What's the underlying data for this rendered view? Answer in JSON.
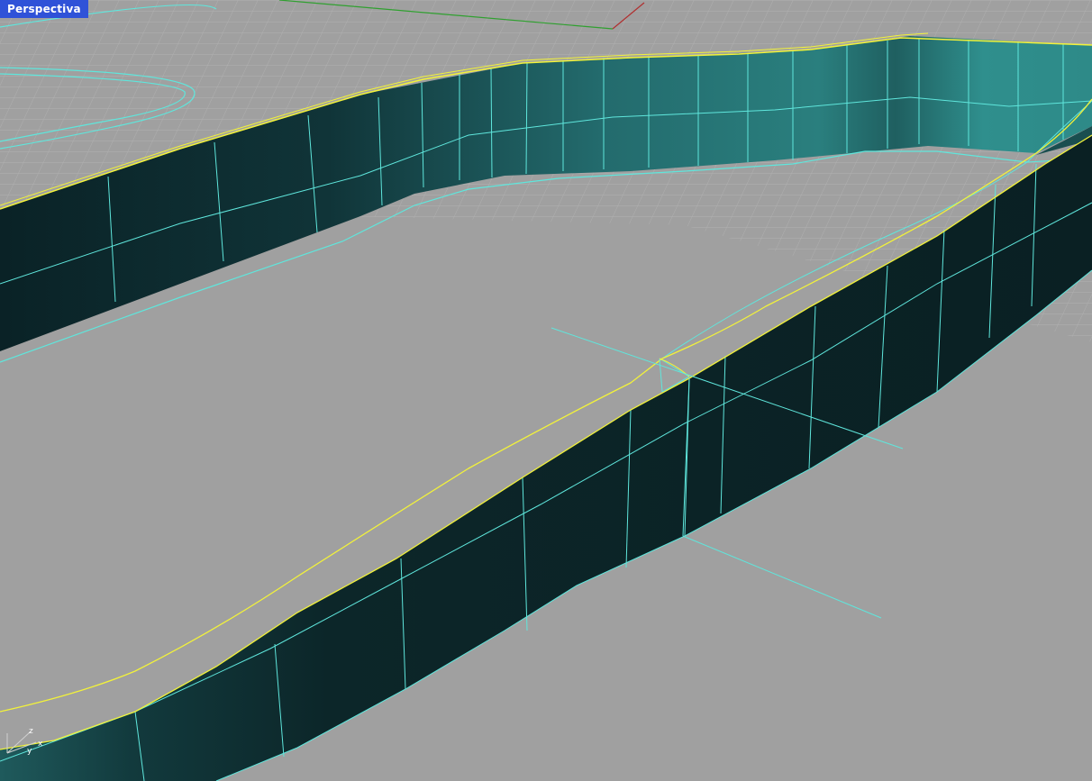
{
  "viewport": {
    "title": "Perspectiva",
    "background_color": "#a0a0a0",
    "grid_color": "#b6b6b6"
  },
  "scene": {
    "surface_dark_color": "#0b2326",
    "surface_light_color": "#2e8f8d",
    "isocurve_color": "#5fe6dc",
    "edge_highlight_color": "#f2f23a",
    "x_axis_color": "#b03030",
    "y_axis_color": "#30a030"
  },
  "axis_gizmo": {
    "x_label": "x",
    "y_label": "y",
    "z_label": "z"
  }
}
